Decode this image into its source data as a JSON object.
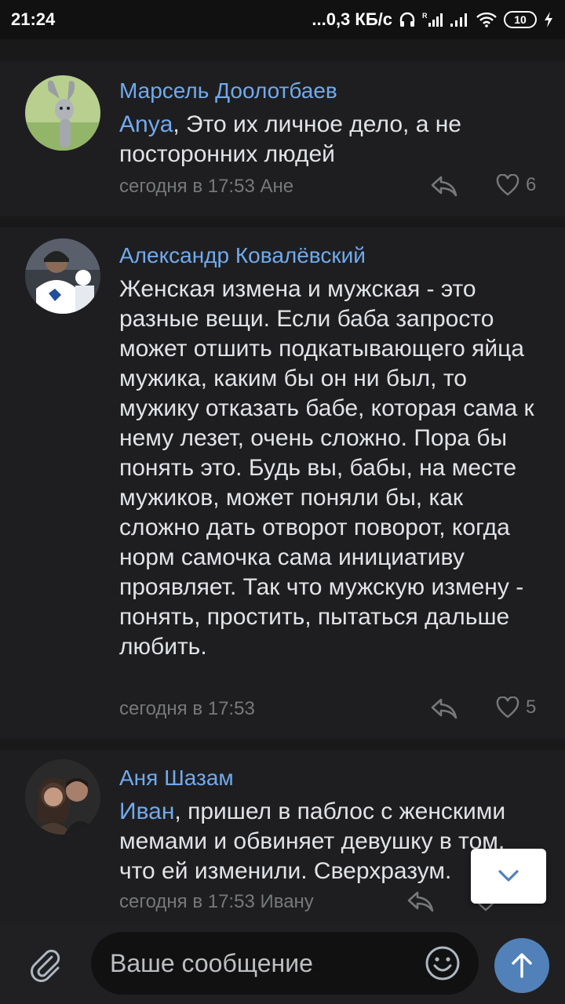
{
  "status_bar": {
    "time": "21:24",
    "network_speed": "...0,3 КБ/с",
    "battery_level": "10",
    "icons": [
      "headphones-icon",
      "signal-roaming-icon",
      "signal-icon",
      "wifi-icon",
      "battery-icon",
      "charging-icon"
    ]
  },
  "comments": [
    {
      "author": "Марсель Доолотбаев",
      "mention": "Anya",
      "text": ", Это их личное дело, а не посторонних людей",
      "meta": "сегодня в 17:53 Ане",
      "likes": "6",
      "avatar": "rabbit-cartoon"
    },
    {
      "author": "Александр Ковалёвский",
      "mention": "",
      "text": "Женская измена и мужская - это разные вещи. Если баба запросто может отшить подкатывающего яйца мужика, каким бы он ни был, то мужику отказать бабе, которая сама к нему лезет, очень сложно. Пора бы понять это. Будь вы, бабы, на месте мужиков, может поняли бы, как сложно дать отворот поворот, когда норм самочка сама инициативу проявляет. Так что мужскую измену - понять, простить, пытаться дальше любить.",
      "meta": "сегодня в 17:53",
      "likes": "5",
      "avatar": "hockey-player"
    },
    {
      "author": "Аня Шазам",
      "mention": "Иван",
      "text": ", пришел в паблос с женскими мемами и обвиняет девушку в том, что ей изменили. Сверхразум.",
      "meta": "сегодня в 17:53 Ивану",
      "likes": "",
      "avatar": "couple-photo"
    }
  ],
  "composer": {
    "placeholder": "Ваше сообщение"
  },
  "colors": {
    "background": "#19191a",
    "card": "#1e1e21",
    "accent": "#71aaeb",
    "send_button": "#5181b8",
    "muted": "#76787a"
  }
}
